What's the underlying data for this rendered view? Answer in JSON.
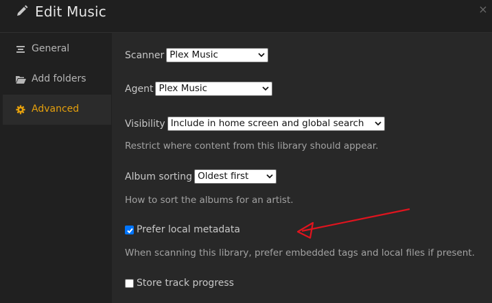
{
  "header": {
    "title": "Edit Music",
    "close_symbol": "×",
    "edit_icon": "pencil-icon"
  },
  "sidebar": {
    "items": [
      {
        "label": "General",
        "icon": "list-icon",
        "active": false
      },
      {
        "label": "Add folders",
        "icon": "folder-icon",
        "active": false
      },
      {
        "label": "Advanced",
        "icon": "gear-icon",
        "active": true
      }
    ]
  },
  "settings": {
    "scanner": {
      "label": "Scanner",
      "value": "Plex Music"
    },
    "agent": {
      "label": "Agent",
      "value": "Plex Music"
    },
    "visibility": {
      "label": "Visibility",
      "value": "Include in home screen and global search",
      "help": "Restrict where content from this library should appear."
    },
    "album_sorting": {
      "label": "Album sorting",
      "value": "Oldest first",
      "help": "How to sort the albums for an artist."
    },
    "prefer_local_metadata": {
      "label": "Prefer local metadata",
      "checked": true,
      "help": "When scanning this library, prefer embedded tags and local files if present."
    },
    "store_track_progress": {
      "label": "Store track progress",
      "checked": false
    }
  },
  "colors": {
    "accent": "#e5a00d",
    "annotation_arrow": "#e0141e",
    "checkbox_checked": "#0075ff"
  }
}
